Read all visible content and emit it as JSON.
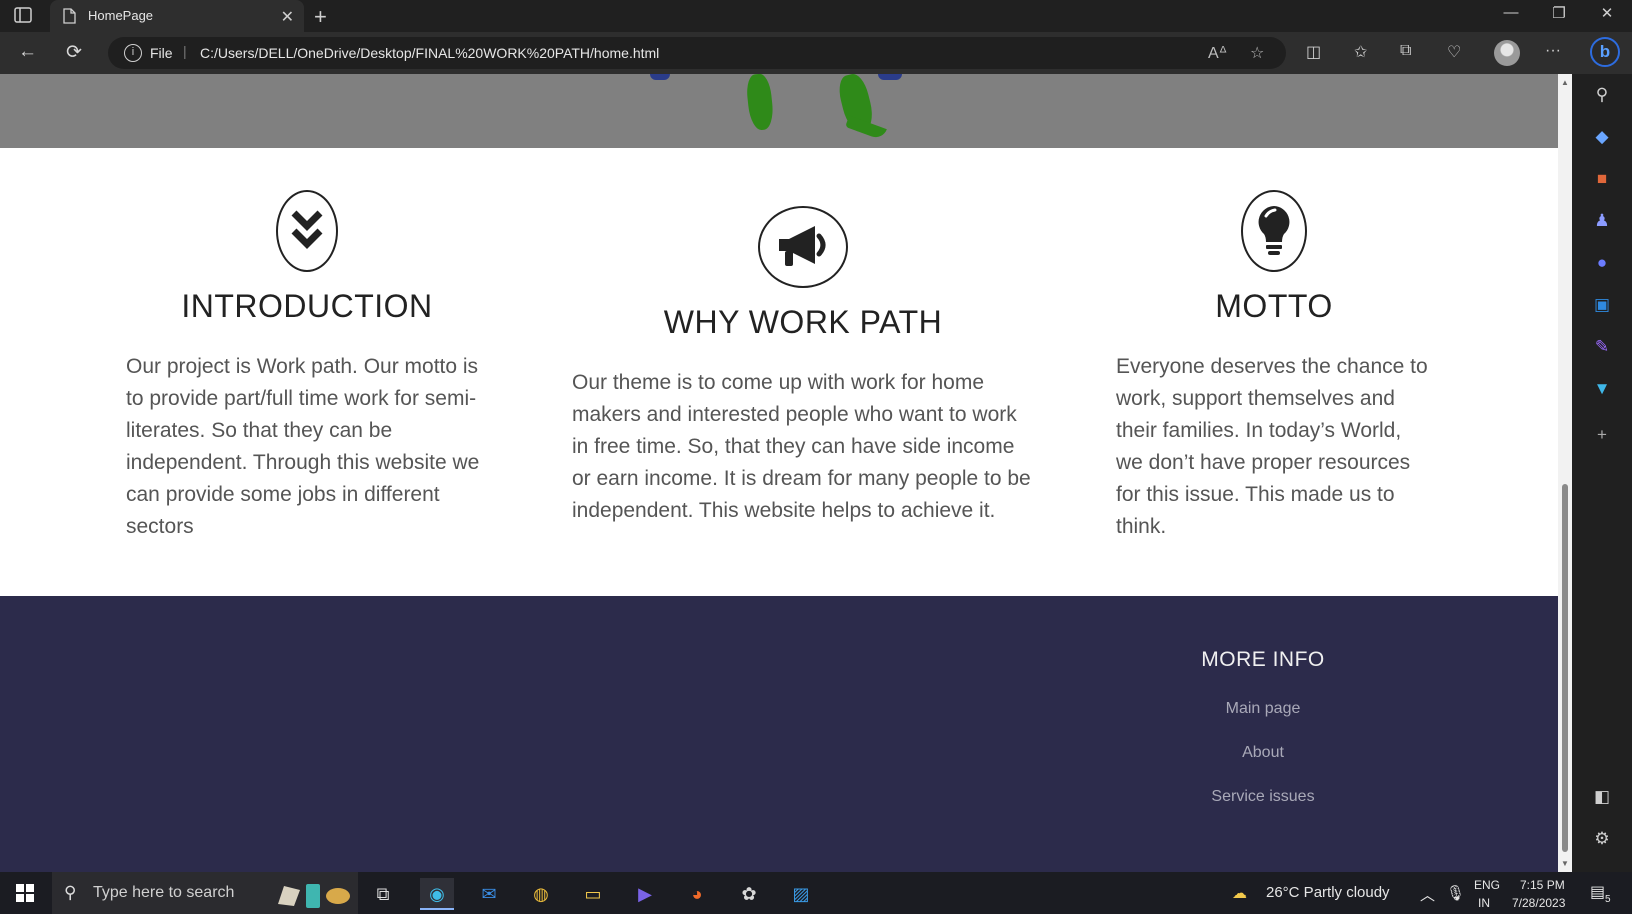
{
  "browser": {
    "tab_title": "HomePage",
    "tab_close": "✕",
    "new_tab": "+",
    "scheme_label": "File",
    "url": "C:/Users/DELL/OneDrive/Desktop/FINAL%20WORK%20PATH/home.html",
    "window_controls": {
      "minimize": "—",
      "restore": "❐",
      "close": "✕"
    },
    "nav": {
      "back": "←",
      "refresh": "⟳"
    }
  },
  "features": [
    {
      "icon": "double-chevron-down-icon",
      "heading": "INTRODUCTION",
      "text": "Our project is Work path. Our motto is to provide part/full time work for semi-literates. So that they can be independent. Through this website we can provide some jobs in different sectors"
    },
    {
      "icon": "megaphone-icon",
      "heading": "WHY WORK PATH",
      "text": "Our theme is to come up with work for home makers and interested people who want to work in free time. So, that they can have side income or earn income. It is dream for many people to be independent. This website helps to achieve it."
    },
    {
      "icon": "lightbulb-icon",
      "heading": "MOTTO",
      "text": "Everyone deserves the chance to work, support themselves and their families. In today’s World, we don’t have proper resources for this issue. This made us to think."
    }
  ],
  "footer": {
    "heading": "MORE INFO",
    "links": [
      "Main page",
      "About",
      "Service issues"
    ]
  },
  "taskbar": {
    "search_placeholder": "Type here to search",
    "weather": "26°C  Partly cloudy",
    "lang_top": "ENG",
    "lang_bottom": "IN",
    "time": "7:15 PM",
    "date": "7/28/2023",
    "notifications": "5"
  },
  "colors": {
    "footer_bg": "#2c2b4b",
    "hero_strip": "#808080",
    "leg_green": "#2f8a19",
    "text_dark": "#222222",
    "text_body": "#555555"
  }
}
